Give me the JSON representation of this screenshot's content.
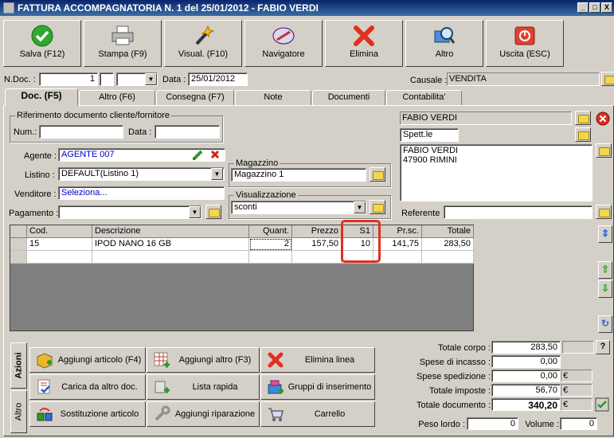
{
  "window": {
    "title": "FATTURA ACCOMPAGNATORIA N. 1  del 25/01/2012 - FABIO VERDI",
    "min": "_",
    "max": "□",
    "close": "X"
  },
  "toolbar": [
    {
      "label": "Salva (F12)",
      "icon": "check-icon"
    },
    {
      "label": "Stampa (F9)",
      "icon": "printer-icon"
    },
    {
      "label": "Visual. (F10)",
      "icon": "magic-wand-icon"
    },
    {
      "label": "Navigatore",
      "icon": "compass-icon"
    },
    {
      "label": "Elimina",
      "icon": "delete-x-icon"
    },
    {
      "label": "Altro",
      "icon": "magnifier-icon"
    },
    {
      "label": "Uscita (ESC)",
      "icon": "power-icon"
    }
  ],
  "header": {
    "ndoc_label": "N.Doc. :",
    "ndoc_value": "1",
    "data_label": "Data :",
    "data_value": "25/01/2012",
    "causale_label": "Causale :",
    "causale_value": "VENDITA"
  },
  "tabs": [
    "Doc. (F5)",
    "Altro (F6)",
    "Consegna (F7)",
    "Note",
    "Documenti",
    "Contabilita'"
  ],
  "rif": {
    "title": "Riferimento documento cliente/fornitore",
    "num_label": "Num.:",
    "data_label": "Data :"
  },
  "agente": {
    "label": "Agente :",
    "value": "AGENTE 007"
  },
  "listino": {
    "label": "Listino :",
    "value": "DEFAULT(Listino 1)"
  },
  "venditore": {
    "label": "Venditore :",
    "value": "Seleziona..."
  },
  "pagamento": {
    "label": "Pagamento :",
    "value": ""
  },
  "magazzino": {
    "title": "Magazzino",
    "value": "Magazzino 1"
  },
  "visualizzazione": {
    "title": "Visualizzazione",
    "value": "sconti"
  },
  "cliente": {
    "name": "FABIO VERDI",
    "title": "Spett.le",
    "address_line1": "FABIO VERDI",
    "address_line2": "47900 RIMINI"
  },
  "referente": {
    "label": "Referente",
    "value": ""
  },
  "grid": {
    "headers": [
      "Cod.",
      "Descrizione",
      "Quant.",
      "Prezzo",
      "S1",
      "Pr.sc.",
      "Totale"
    ],
    "rows": [
      [
        "15",
        "IPOD NANO 16 GB",
        "2",
        "157,50",
        "10",
        "141,75",
        "283,50"
      ]
    ]
  },
  "vtabs": [
    "Azioni",
    "Altro"
  ],
  "actions": [
    {
      "label": "Aggiungi articolo (F4)",
      "icon": "add-box-icon"
    },
    {
      "label": "Aggiungi altro (F3)",
      "icon": "add-grid-icon"
    },
    {
      "label": "Elimina linea",
      "icon": "delete-x-icon"
    },
    {
      "label": "Carica da altro doc.",
      "icon": "load-doc-icon"
    },
    {
      "label": "Lista rapida",
      "icon": "quick-list-icon"
    },
    {
      "label": "Gruppi di inserimento",
      "icon": "group-insert-icon"
    },
    {
      "label": "Sostituzione articolo",
      "icon": "replace-icon"
    },
    {
      "label": "Aggiungi riparazione",
      "icon": "wrench-icon"
    },
    {
      "label": "Carrello",
      "icon": "cart-icon"
    }
  ],
  "totals": {
    "corpo_label": "Totale corpo :",
    "corpo": "283,50",
    "help": "?",
    "incasso_label": "Spese di incasso :",
    "incasso": "0,00",
    "spedizione_label": "Spese spedizione :",
    "spedizione": "0,00",
    "imposte_label": "Totale imposte :",
    "imposte": "56,70",
    "documento_label": "Totale documento :",
    "documento": "340,20",
    "currency": "€",
    "peso_label": "Peso lordo :",
    "peso": "0",
    "volume_label": "Volume :",
    "volume": "0"
  },
  "colors": {
    "title_bar": "#0a246a",
    "highlight": "#e03020",
    "link_blue": "#0000c0"
  }
}
